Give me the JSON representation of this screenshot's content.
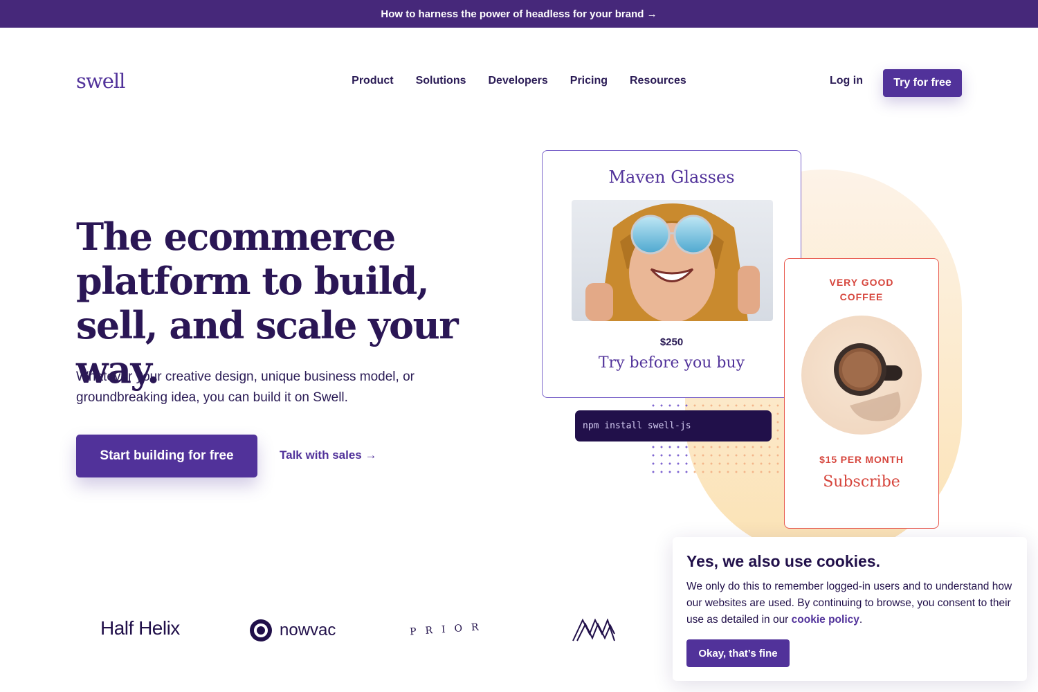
{
  "banner": {
    "text": "How to harness the power of headless for your brand →"
  },
  "header": {
    "logo": "swell",
    "nav": [
      "Product",
      "Solutions",
      "Developers",
      "Pricing",
      "Resources"
    ],
    "login": "Log in",
    "cta": "Try for free"
  },
  "hero": {
    "title": "The ecommerce platform to build, sell, and scale your way.",
    "subtitle": "Whatever your creative design, unique business model, or groundbreaking idea, you can build it on Swell.",
    "primary_cta": "Start building for free",
    "secondary_cta": "Talk with sales →"
  },
  "product_card": {
    "title": "Maven Glasses",
    "price": "$250",
    "cta": "Try before you buy"
  },
  "code_snippet": "npm install swell-js",
  "subscription_card": {
    "title": "VERY GOOD COFFEE",
    "price": "$15 PER MONTH",
    "cta": "Subscribe"
  },
  "logos": {
    "half_helix": "Half Helix",
    "nowvac": "nowvac",
    "prior": "PRIOR"
  },
  "cookie": {
    "title": "Yes, we also use cookies.",
    "text": "We only do this to remember logged-in users and to understand how our websites are used. By continuing to browse, you consent to their use as detailed in our",
    "link": "cookie policy",
    "suffix": ".",
    "button": "Okay, that’s fine"
  },
  "colors": {
    "brand": "#51329a",
    "banner": "#46287a",
    "accent_red": "#d6453c",
    "dark": "#21104a"
  }
}
